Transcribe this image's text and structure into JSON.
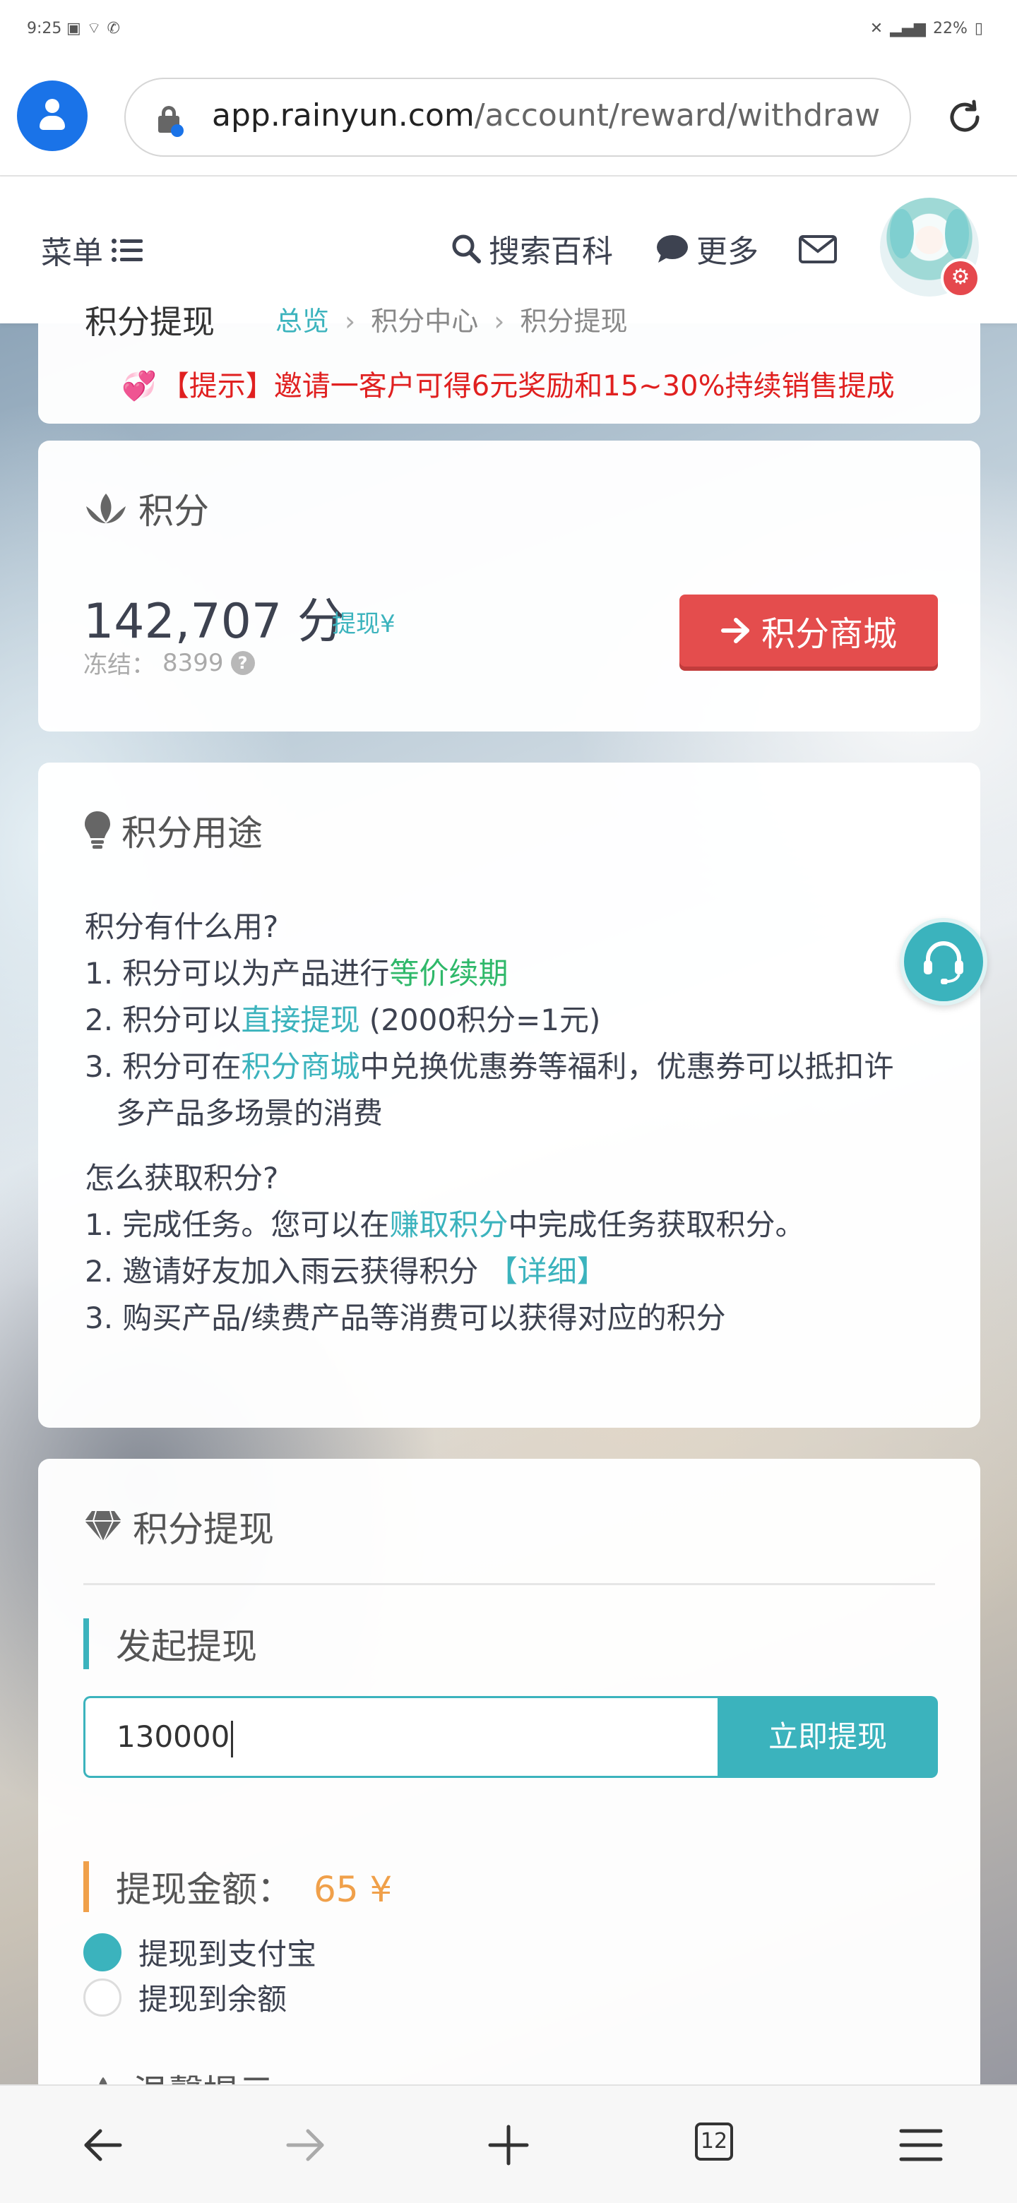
{
  "status_bar": {
    "time": "9:25",
    "battery": "22%"
  },
  "browser": {
    "url_host": "app.rainyun.com",
    "url_path": "/account/reward/withdraw",
    "tabs_count": "12"
  },
  "site_header": {
    "menu_label": "菜单",
    "search_label": "搜索百科",
    "more_label": "更多"
  },
  "breadcrumb": {
    "page_title": "积分提现",
    "items": [
      "总览",
      "积分中心",
      "积分提现"
    ]
  },
  "notice": {
    "text": "【提示】邀请一客户可得6元奖励和15~30%持续销售提成"
  },
  "points_card": {
    "title": "积分",
    "value": "142,707 分",
    "withdraw_link": "提现¥",
    "frozen_label": "冻结：",
    "frozen_value": "8399",
    "shop_button": "积分商城"
  },
  "usage_card": {
    "title": "积分用途",
    "q1": "积分有什么用?",
    "use1_prefix": "1. 积分可以为产品进行",
    "use1_link": "等价续期",
    "use2_prefix": "2. 积分可以",
    "use2_link": "直接提现",
    "use2_suffix": " (2000积分=1元)",
    "use3_prefix": "3. 积分可在",
    "use3_link": "积分商城",
    "use3_suffix": "中兑换优惠券等福利，优惠券可以抵扣许",
    "use3_cont": "多产品多场景的消费",
    "q2": "怎么获取积分?",
    "get1_prefix": "1. 完成任务。您可以在",
    "get1_link": "赚取积分",
    "get1_suffix": "中完成任务获取积分。",
    "get2_prefix": "2. 邀请好友加入雨云获得积分 ",
    "get2_link": "【详细】",
    "get3": "3. 购买产品/续费产品等消费可以获得对应的积分"
  },
  "withdraw_card": {
    "title": "积分提现",
    "start_title": "发起提现",
    "input_value": "130000",
    "submit_button": "立即提现",
    "amount_label": "提现金额：",
    "amount_value": "65 ¥",
    "option_alipay": "提现到支付宝",
    "option_balance": "提现到余额",
    "tips_title": "温馨提示"
  },
  "colors": {
    "accent": "#3bb3bd",
    "danger": "#e44d4d",
    "success": "#2fb86a",
    "warning": "#f0a04a",
    "browser_blue": "#1a73e8"
  }
}
